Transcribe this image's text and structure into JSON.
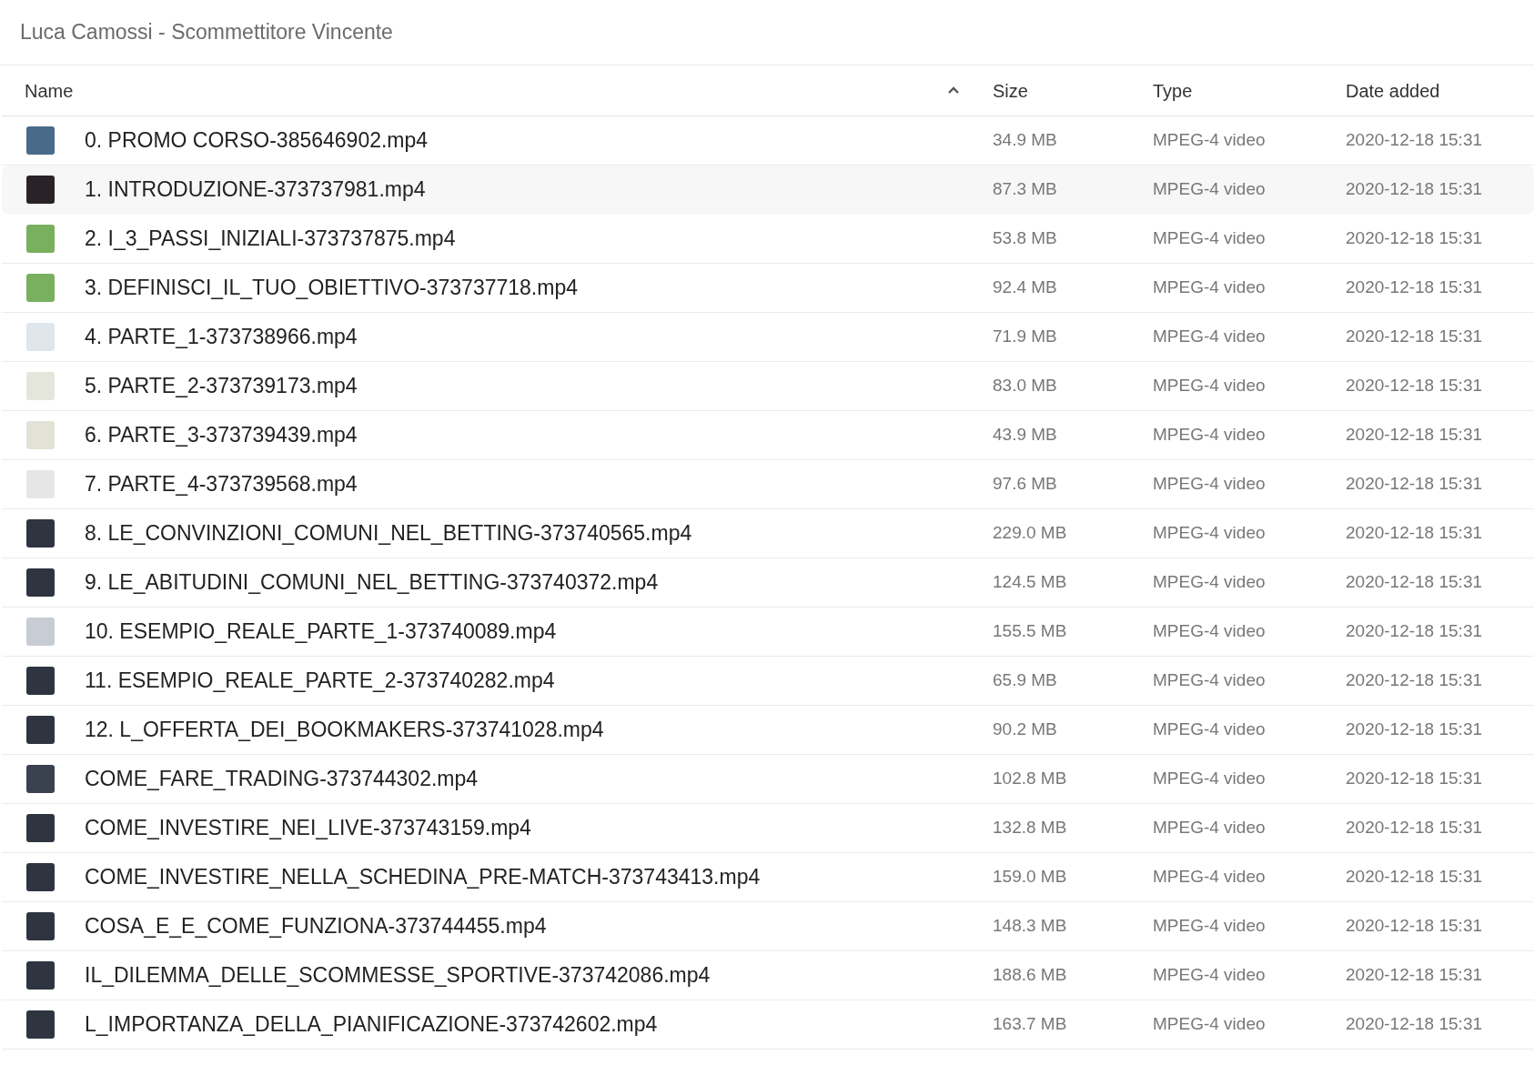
{
  "title": "Luca Camossi - Scommettitore Vincente",
  "table": {
    "columns": [
      {
        "label": "Name",
        "sorted": true
      },
      {
        "label": "Size",
        "sorted": false
      },
      {
        "label": "Type",
        "sorted": false
      },
      {
        "label": "Date added",
        "sorted": false
      }
    ],
    "rows": [
      {
        "name": "0. PROMO CORSO-385646902.mp4",
        "size": "34.9 MB",
        "type": "MPEG-4 video",
        "date": "2020-12-18 15:31",
        "selected": false,
        "color": "#4a6a8a"
      },
      {
        "name": "1. INTRODUZIONE-373737981.mp4",
        "size": "87.3 MB",
        "type": "MPEG-4 video",
        "date": "2020-12-18 15:31",
        "selected": true,
        "color": "#2a2226"
      },
      {
        "name": "2. I_3_PASSI_INIZIALI-373737875.mp4",
        "size": "53.8 MB",
        "type": "MPEG-4 video",
        "date": "2020-12-18 15:31",
        "selected": false,
        "color": "#78b060"
      },
      {
        "name": "3. DEFINISCI_IL_TUO_OBIETTIVO-373737718.mp4",
        "size": "92.4 MB",
        "type": "MPEG-4 video",
        "date": "2020-12-18 15:31",
        "selected": false,
        "color": "#78b060"
      },
      {
        "name": "4. PARTE_1-373738966.mp4",
        "size": "71.9 MB",
        "type": "MPEG-4 video",
        "date": "2020-12-18 15:31",
        "selected": false,
        "color": "#dfe6ec"
      },
      {
        "name": "5. PARTE_2-373739173.mp4",
        "size": "83.0 MB",
        "type": "MPEG-4 video",
        "date": "2020-12-18 15:31",
        "selected": false,
        "color": "#e4e6dc"
      },
      {
        "name": "6. PARTE_3-373739439.mp4",
        "size": "43.9 MB",
        "type": "MPEG-4 video",
        "date": "2020-12-18 15:31",
        "selected": false,
        "color": "#e2e2d6"
      },
      {
        "name": "7. PARTE_4-373739568.mp4",
        "size": "97.6 MB",
        "type": "MPEG-4 video",
        "date": "2020-12-18 15:31",
        "selected": false,
        "color": "#e6e6e6"
      },
      {
        "name": "8. LE_CONVINZIONI_COMUNI_NEL_BETTING-373740565.mp4",
        "size": "229.0 MB",
        "type": "MPEG-4 video",
        "date": "2020-12-18 15:31",
        "selected": false,
        "color": "#2e3540"
      },
      {
        "name": "9. LE_ABITUDINI_COMUNI_NEL_BETTING-373740372.mp4",
        "size": "124.5 MB",
        "type": "MPEG-4 video",
        "date": "2020-12-18 15:31",
        "selected": false,
        "color": "#2e3540"
      },
      {
        "name": "10. ESEMPIO_REALE_PARTE_1-373740089.mp4",
        "size": "155.5 MB",
        "type": "MPEG-4 video",
        "date": "2020-12-18 15:31",
        "selected": false,
        "color": "#c8ccd4"
      },
      {
        "name": "11. ESEMPIO_REALE_PARTE_2-373740282.mp4",
        "size": "65.9 MB",
        "type": "MPEG-4 video",
        "date": "2020-12-18 15:31",
        "selected": false,
        "color": "#2e3540"
      },
      {
        "name": "12. L_OFFERTA_DEI_BOOKMAKERS-373741028.mp4",
        "size": "90.2 MB",
        "type": "MPEG-4 video",
        "date": "2020-12-18 15:31",
        "selected": false,
        "color": "#2e3540"
      },
      {
        "name": "COME_FARE_TRADING-373744302.mp4",
        "size": "102.8 MB",
        "type": "MPEG-4 video",
        "date": "2020-12-18 15:31",
        "selected": false,
        "color": "#3a4250"
      },
      {
        "name": "COME_INVESTIRE_NEI_LIVE-373743159.mp4",
        "size": "132.8 MB",
        "type": "MPEG-4 video",
        "date": "2020-12-18 15:31",
        "selected": false,
        "color": "#2e3540"
      },
      {
        "name": "COME_INVESTIRE_NELLA_SCHEDINA_PRE-MATCH-373743413.mp4",
        "size": "159.0 MB",
        "type": "MPEG-4 video",
        "date": "2020-12-18 15:31",
        "selected": false,
        "color": "#2e3540"
      },
      {
        "name": "COSA_E_E_COME_FUNZIONA-373744455.mp4",
        "size": "148.3 MB",
        "type": "MPEG-4 video",
        "date": "2020-12-18 15:31",
        "selected": false,
        "color": "#2e3540"
      },
      {
        "name": "IL_DILEMMA_DELLE_SCOMMESSE_SPORTIVE-373742086.mp4",
        "size": "188.6 MB",
        "type": "MPEG-4 video",
        "date": "2020-12-18 15:31",
        "selected": false,
        "color": "#2e3540"
      },
      {
        "name": "L_IMPORTANZA_DELLA_PIANIFICAZIONE-373742602.mp4",
        "size": "163.7 MB",
        "type": "MPEG-4 video",
        "date": "2020-12-18 15:31",
        "selected": false,
        "color": "#2e3540"
      }
    ]
  }
}
